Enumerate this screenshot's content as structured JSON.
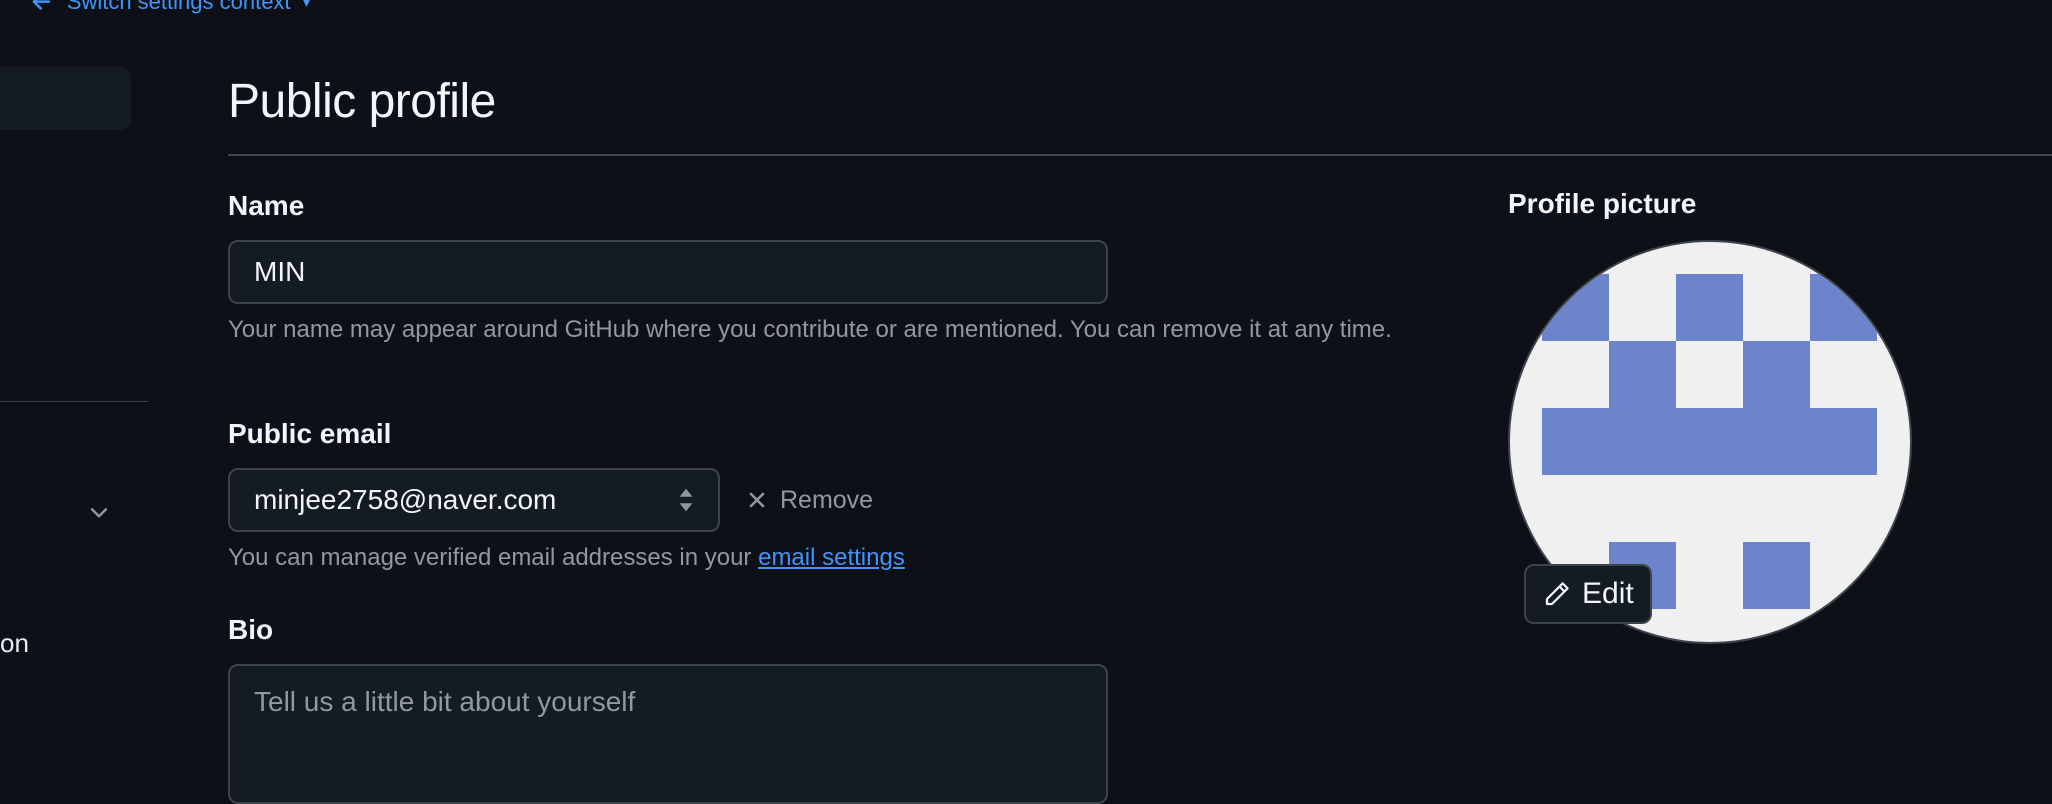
{
  "nav": {
    "context_link": "Switch settings context",
    "sidebar_partial_label": "on"
  },
  "header": {
    "title": "Public profile"
  },
  "name": {
    "label": "Name",
    "value": "MIN",
    "hint": "Your name may appear around GitHub where you contribute or are mentioned. You can remove it at any time."
  },
  "public_email": {
    "label": "Public email",
    "selected": "minjee2758@naver.com",
    "remove_label": "Remove",
    "hint_prefix": "You can manage verified email addresses in your ",
    "hint_link": "email settings"
  },
  "bio": {
    "label": "Bio",
    "placeholder": "Tell us a little bit about yourself"
  },
  "profile_picture": {
    "label": "Profile picture",
    "edit_label": "Edit",
    "identicon_color": "#6b84cc"
  },
  "colors": {
    "background": "#0d1117",
    "accent": "#4493f8",
    "muted": "#9198a1",
    "border": "#3d444d"
  },
  "icons": [
    "arrow-left-icon",
    "chevron-down-icon",
    "select-arrows-icon",
    "x-icon",
    "pencil-icon"
  ]
}
